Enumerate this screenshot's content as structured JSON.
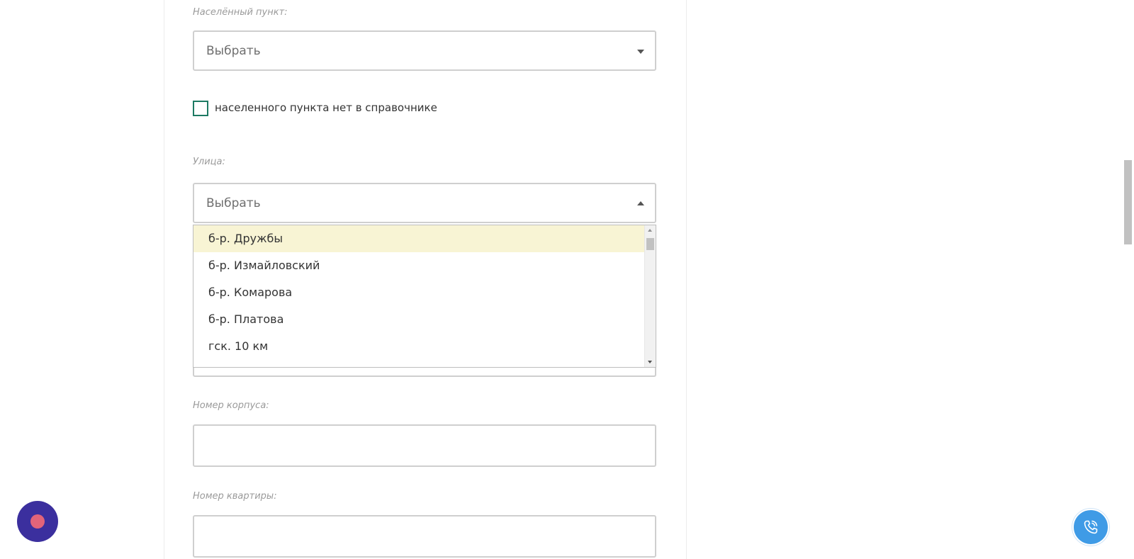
{
  "form": {
    "locality": {
      "label": "Населённый пункт:",
      "placeholder": "Выбрать"
    },
    "locality_missing": {
      "label": "населенного пункта нет в справочнике",
      "checked": false
    },
    "street": {
      "label": "Улица:",
      "placeholder": "Выбрать",
      "dropdown_open": true,
      "options": [
        "б-р. Дружбы",
        "б-р. Измайловский",
        "б-р. Комарова",
        "б-р. Платова",
        "гск. 10 км"
      ],
      "highlighted_index": 0
    },
    "building": {
      "label": "Номер корпуса:",
      "value": ""
    },
    "apartment": {
      "label": "Номер квартиры:",
      "value": ""
    }
  },
  "widgets": {
    "record_icon": "record-dot-icon",
    "call_icon": "phone-call-icon",
    "colors": {
      "checkbox_border": "#1d7a63",
      "highlight": "#f8f4d4",
      "record_bg": "#3b2f9e",
      "record_dot": "#e2647a",
      "call_bg": "#3f9be6"
    }
  }
}
